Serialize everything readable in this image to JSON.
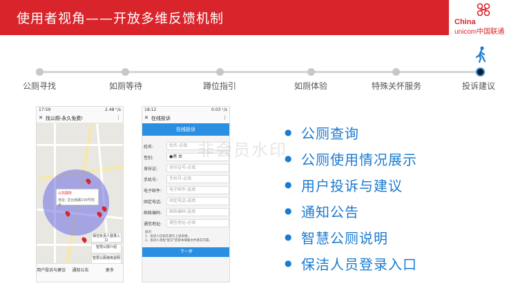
{
  "header": {
    "title": "使用者视角——开放多维反馈机制",
    "bg_color": "#d8242a",
    "logo": {
      "line1": "China",
      "line2": "unicom中国联通"
    }
  },
  "timeline": {
    "steps": [
      {
        "label": "公厕寻找"
      },
      {
        "label": "如厕等待"
      },
      {
        "label": "蹲位指引"
      },
      {
        "label": "如厕体验"
      },
      {
        "label": "特殊关怀服务"
      },
      {
        "label": "投诉建议"
      }
    ],
    "active_index": 5,
    "active_icon": "walking-person-icon"
  },
  "phone1": {
    "status_time": "17:59",
    "status_right": "2.48 ᵏ/s",
    "title": "找公厕-永久免费!",
    "popup_title": "公共厕所",
    "popup_address": "地址: 龙台南路158号附近",
    "side_buttons": [
      "保洁负责人登录入口",
      "智慧公厕介绍",
      "智慧公厕使用说明"
    ],
    "nav": [
      "用户投诉与建议",
      "通知公告",
      "更多"
    ]
  },
  "phone2": {
    "status_time": "18:12",
    "status_right": "0.03 ᵏ/s",
    "title": "在线投诉",
    "tab": "在线投诉",
    "form": [
      {
        "label": "姓名:",
        "value": "姓名-必填"
      },
      {
        "label": "性别:",
        "value": "●男  女"
      },
      {
        "label": "身份证:",
        "value": "身份证号-必填"
      },
      {
        "label": "手机号:",
        "value": "手机号-必填"
      },
      {
        "label": "电子邮件:",
        "value": "电子邮件-选填"
      },
      {
        "label": "固定电话:",
        "value": "固定电话-选填"
      },
      {
        "label": "邮政编码:",
        "value": "邮政编码-选填"
      },
      {
        "label": "通信地址:",
        "value": "通信地址-必填"
      }
    ],
    "notice": "提示:\n1、投诉人应如实填写上述表格。\n2、投诉人承担\"提交\"后即本填报文件真实可靠。",
    "next_button": "下一步"
  },
  "features": [
    "公厕查询",
    "公厕使用情况展示",
    "用户投诉与建议",
    "通知公告",
    "智慧公厕说明",
    "保洁人员登录入口"
  ],
  "watermark": "非会员水印",
  "accent_color": "#1a7bd0"
}
